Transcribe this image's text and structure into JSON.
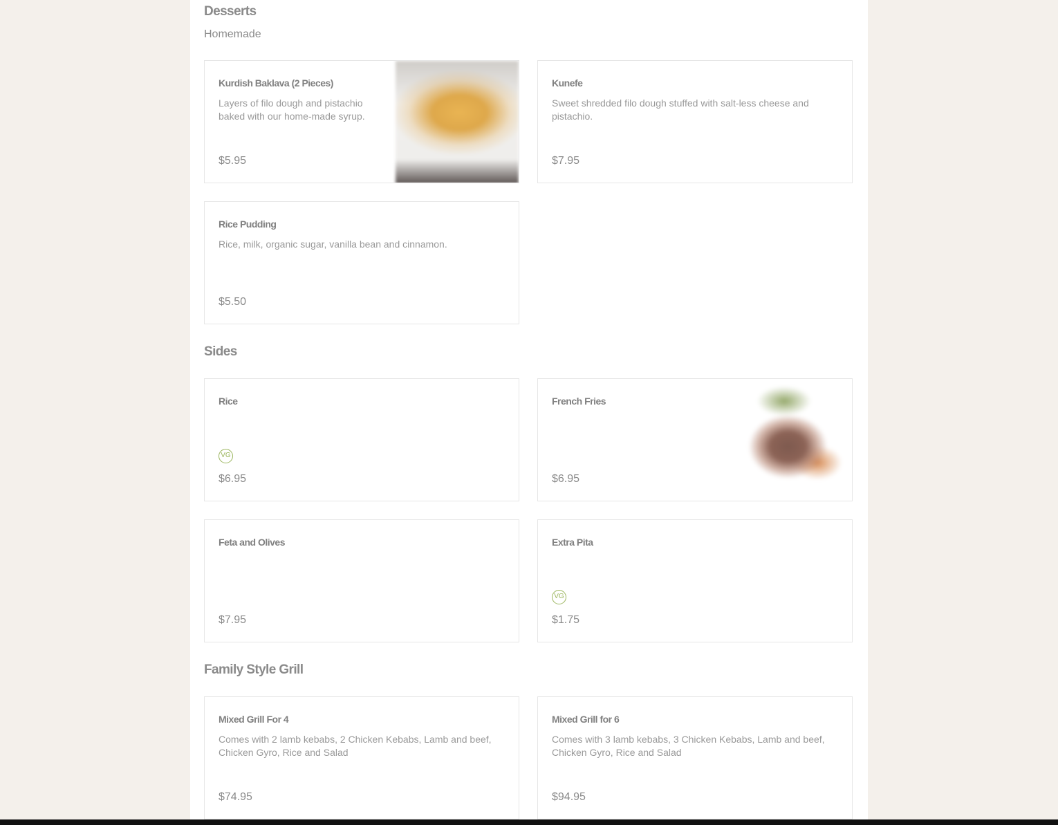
{
  "sections": [
    {
      "title": "Desserts",
      "subtitle": "Homemade",
      "items": [
        {
          "name": "Kurdish Baklava (2 Pieces)",
          "description": "Layers of filo dough and pistachio baked with our home-made syrup.",
          "price": "$5.95"
        },
        {
          "name": "Kunefe",
          "description": "Sweet shredded filo dough stuffed with salt-less cheese and pistachio.",
          "price": "$7.95"
        },
        {
          "name": "Rice Pudding",
          "description": "Rice, milk, organic sugar, vanilla bean and cinnamon.",
          "price": "$5.50"
        }
      ]
    },
    {
      "title": "Sides",
      "items": [
        {
          "name": "Rice",
          "badge": "VG",
          "price": "$6.95"
        },
        {
          "name": "French Fries",
          "price": "$6.95"
        },
        {
          "name": "Feta and Olives",
          "price": "$7.95"
        },
        {
          "name": "Extra Pita",
          "badge": "VG",
          "price": "$1.75"
        }
      ]
    },
    {
      "title": "Family Style Grill",
      "items": [
        {
          "name": "Mixed Grill For 4",
          "description": "Comes with 2 lamb kebabs, 2 Chicken Kebabs, Lamb and beef, Chicken Gyro, Rice and Salad",
          "price": "$74.95"
        },
        {
          "name": "Mixed Grill for 6",
          "description": "Comes with 3 lamb kebabs, 3 Chicken Kebabs, Lamb and beef, Chicken Gyro, Rice and Salad",
          "price": "$94.95"
        }
      ]
    }
  ],
  "colors": {
    "page_background": "#f4f0eb",
    "vegan_badge": "#9ab55c",
    "text": "#8a8a8a"
  }
}
